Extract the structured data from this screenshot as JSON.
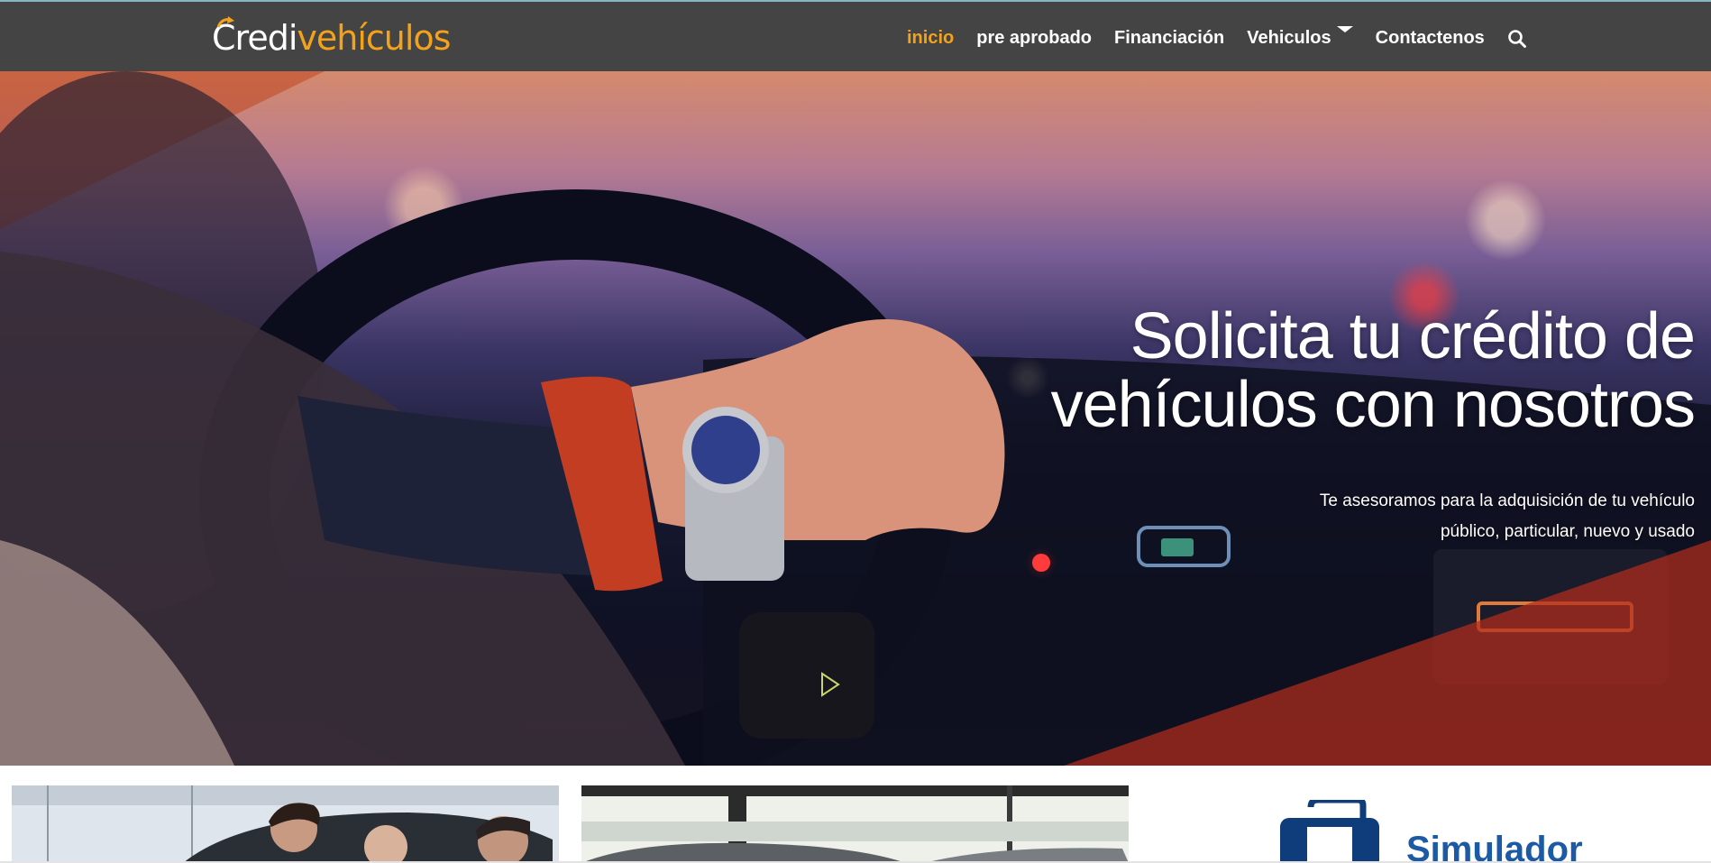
{
  "brand": {
    "logo_part1": "Credi",
    "logo_part2": "vehículos",
    "primary_color": "#444444",
    "accent_color": "#f5a21b"
  },
  "nav": {
    "items": [
      {
        "label": "inicio",
        "active": true
      },
      {
        "label": "pre aprobado",
        "active": false
      },
      {
        "label": "Financiación",
        "active": false
      },
      {
        "label": "Vehiculos",
        "active": false,
        "has_dropdown": true
      },
      {
        "label": "Contactenos",
        "active": false
      }
    ],
    "search_icon": "search-icon"
  },
  "hero": {
    "title_line1": "Solicita tu crédito de",
    "title_line2": "vehículos con nosotros",
    "subtitle_line1": "Te asesoramos para la adquisición  de tu vehículo",
    "subtitle_line2": "público, particular, nuevo y usado",
    "overlay_color": "#b12d1c"
  },
  "cards": {
    "simulador_label": "Simulador",
    "simulador_icon": "calculator-icon"
  }
}
